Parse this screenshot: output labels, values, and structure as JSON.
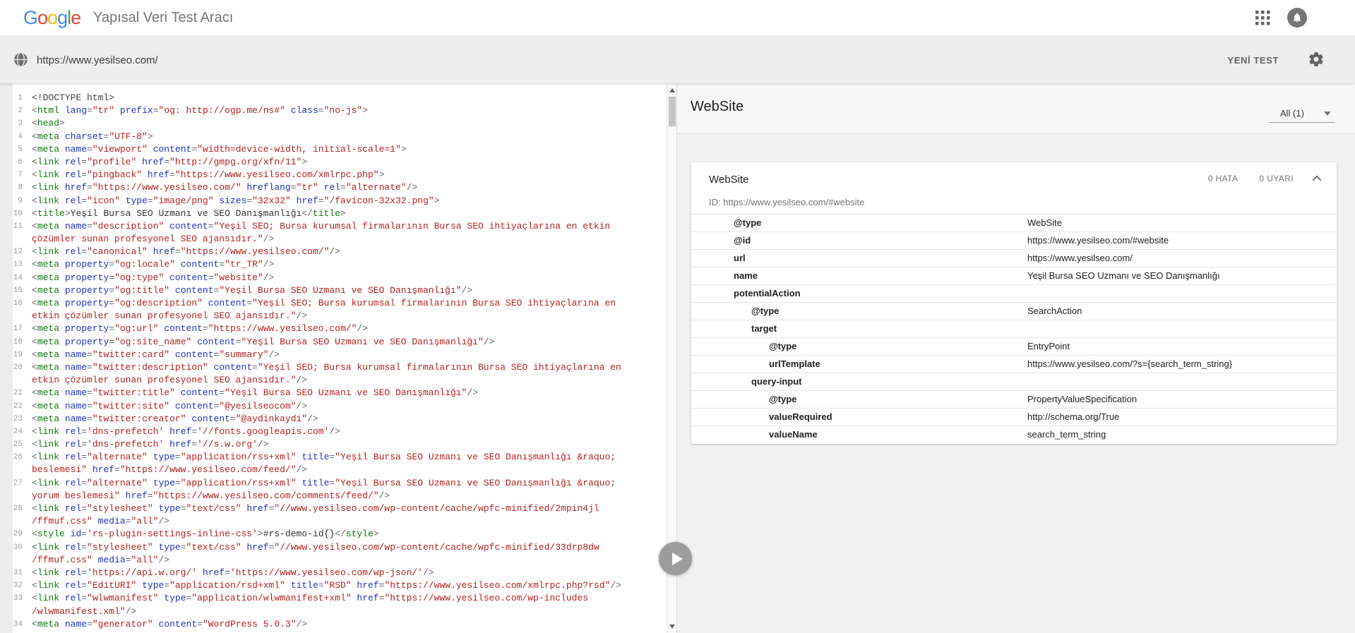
{
  "header": {
    "title": "Yapısal Veri Test Aracı",
    "logo_letters": [
      {
        "ch": "G",
        "color": "#4285F4"
      },
      {
        "ch": "o",
        "color": "#EA4335"
      },
      {
        "ch": "o",
        "color": "#FBBC05"
      },
      {
        "ch": "g",
        "color": "#4285F4"
      },
      {
        "ch": "l",
        "color": "#34A853"
      },
      {
        "ch": "e",
        "color": "#EA4335"
      }
    ]
  },
  "toolbar": {
    "url": "https://www.yesilseo.com/",
    "new_test": "YENİ TEST"
  },
  "colors": {
    "code": {
      "tag": "#117711",
      "attr": "#2233bb",
      "value": "#b22222",
      "punct": "#666666",
      "plain": "#333333",
      "doctype": "#444444"
    }
  },
  "code": {
    "rows": [
      {
        "n": "1",
        "t": "<!DOCTYPE html>"
      },
      {
        "n": "2",
        "t": "<html lang=\"tr\" prefix=\"og: http://ogp.me/ns#\" class=\"no-js\">"
      },
      {
        "n": "3",
        "t": "<head>"
      },
      {
        "n": "4",
        "t": "<meta charset=\"UTF-8\">"
      },
      {
        "n": "5",
        "t": "<meta name=\"viewport\" content=\"width=device-width, initial-scale=1\">"
      },
      {
        "n": "6",
        "t": "<link rel=\"profile\" href=\"http://gmpg.org/xfn/11\">"
      },
      {
        "n": "7",
        "t": "<link rel=\"pingback\" href=\"https://www.yesilseo.com/xmlrpc.php\">"
      },
      {
        "n": "8",
        "t": "<link href=\"https://www.yesilseo.com/\" hreflang=\"tr\" rel=\"alternate\"/>"
      },
      {
        "n": "9",
        "t": "<link rel=\"icon\" type=\"image/png\" sizes=\"32x32\" href=\"/favicon-32x32.png\">"
      },
      {
        "n": "10",
        "t": "<title>Yeşil Bursa SEO Uzmanı ve SEO Danışmanlığı</title>"
      },
      {
        "n": "11",
        "t": "<meta name=\"description\" content=\"Yeşil SEO; Bursa kurumsal firmalarının Bursa SEO ihtiyaçlarına en etkin"
      },
      {
        "n": "",
        "t": "çözümler sunan profesyonel SEO ajansıdır.\"/>"
      },
      {
        "n": "12",
        "t": "<link rel=\"canonical\" href=\"https://www.yesilseo.com/\"/>"
      },
      {
        "n": "13",
        "t": "<meta property=\"og:locale\" content=\"tr_TR\"/>"
      },
      {
        "n": "14",
        "t": "<meta property=\"og:type\" content=\"website\"/>"
      },
      {
        "n": "15",
        "t": "<meta property=\"og:title\" content=\"Yeşil Bursa SEO Uzmanı ve SEO Danışmanlığı\"/>"
      },
      {
        "n": "16",
        "t": "<meta property=\"og:description\" content=\"Yeşil SEO; Bursa kurumsal firmalarının Bursa SEO ihtiyaçlarına en"
      },
      {
        "n": "",
        "t": "etkin çözümler sunan profesyonel SEO ajansıdır.\"/>"
      },
      {
        "n": "17",
        "t": "<meta property=\"og:url\" content=\"https://www.yesilseo.com/\"/>"
      },
      {
        "n": "18",
        "t": "<meta property=\"og:site_name\" content=\"Yeşil Bursa SEO Uzmanı ve SEO Danışmanlığı\"/>"
      },
      {
        "n": "19",
        "t": "<meta name=\"twitter:card\" content=\"summary\"/>"
      },
      {
        "n": "20",
        "t": "<meta name=\"twitter:description\" content=\"Yeşil SEO; Bursa kurumsal firmalarının Bursa SEO ihtiyaçlarına en"
      },
      {
        "n": "",
        "t": "etkin çözümler sunan profesyonel SEO ajansıdır.\"/>"
      },
      {
        "n": "21",
        "t": "<meta name=\"twitter:title\" content=\"Yeşil Bursa SEO Uzmanı ve SEO Danışmanlığı\"/>"
      },
      {
        "n": "22",
        "t": "<meta name=\"twitter:site\" content=\"@yesilseocom\"/>"
      },
      {
        "n": "23",
        "t": "<meta name=\"twitter:creator\" content=\"@aydinkaydi\"/>"
      },
      {
        "n": "24",
        "t": "<link rel='dns-prefetch' href='//fonts.googleapis.com'/>"
      },
      {
        "n": "25",
        "t": "<link rel='dns-prefetch' href='//s.w.org'/>"
      },
      {
        "n": "26",
        "t": "<link rel=\"alternate\" type=\"application/rss+xml\" title=\"Yeşil Bursa SEO Uzmanı ve SEO Danışmanlığı &raquo;"
      },
      {
        "n": "",
        "t": "beslemesi\" href=\"https://www.yesilseo.com/feed/\"/>"
      },
      {
        "n": "27",
        "t": "<link rel=\"alternate\" type=\"application/rss+xml\" title=\"Yeşil Bursa SEO Uzmanı ve SEO Danışmanlığı &raquo;"
      },
      {
        "n": "",
        "t": "yorum beslemesi\" href=\"https://www.yesilseo.com/comments/feed/\"/>"
      },
      {
        "n": "28",
        "t": "<link rel=\"stylesheet\" type=\"text/css\" href=\"//www.yesilseo.com/wp-content/cache/wpfc-minified/2mpin4jl"
      },
      {
        "n": "",
        "t": "/ffmuf.css\" media=\"all\"/>"
      },
      {
        "n": "29",
        "t": "<style id='rs-plugin-settings-inline-css'>#rs-demo-id{}</style>"
      },
      {
        "n": "30",
        "t": "<link rel=\"stylesheet\" type=\"text/css\" href=\"//www.yesilseo.com/wp-content/cache/wpfc-minified/33drp8dw"
      },
      {
        "n": "",
        "t": "/ffmuf.css\" media=\"all\"/>"
      },
      {
        "n": "31",
        "t": "<link rel='https://api.w.org/' href='https://www.yesilseo.com/wp-json/'/>"
      },
      {
        "n": "32",
        "t": "<link rel=\"EditURI\" type=\"application/rsd+xml\" title=\"RSD\" href=\"https://www.yesilseo.com/xmlrpc.php?rsd\"/>"
      },
      {
        "n": "33",
        "t": "<link rel=\"wlwmanifest\" type=\"application/wlwmanifest+xml\" href=\"https://www.yesilseo.com/wp-includes"
      },
      {
        "n": "",
        "t": "/wlwmanifest.xml\"/>"
      },
      {
        "n": "34",
        "t": "<meta name=\"generator\" content=\"WordPress 5.0.3\"/>"
      }
    ]
  },
  "result": {
    "panel_title": "WebSite",
    "filter_label": "All (1)",
    "card": {
      "title": "WebSite",
      "errors": "0 HATA",
      "warnings": "0 UYARI",
      "id_line": "ID: https://www.yesilseo.com/#website",
      "rows": [
        {
          "level": 1,
          "key": "@type",
          "value": "WebSite"
        },
        {
          "level": 1,
          "key": "@id",
          "value": "https://www.yesilseo.com/#website"
        },
        {
          "level": 1,
          "key": "url",
          "value": "https://www.yesilseo.com/"
        },
        {
          "level": 1,
          "key": "name",
          "value": "Yeşil Bursa SEO Uzmanı ve SEO Danışmanlığı"
        },
        {
          "level": 1,
          "key": "potentialAction",
          "value": ""
        },
        {
          "level": 2,
          "key": "@type",
          "value": "SearchAction"
        },
        {
          "level": 2,
          "key": "target",
          "value": ""
        },
        {
          "level": 3,
          "key": "@type",
          "value": "EntryPoint"
        },
        {
          "level": 3,
          "key": "urlTemplate",
          "value": "https://www.yesilseo.com/?s={search_term_string}"
        },
        {
          "level": 2,
          "key": "query-input",
          "value": ""
        },
        {
          "level": 3,
          "key": "@type",
          "value": "PropertyValueSpecification"
        },
        {
          "level": 3,
          "key": "valueRequired",
          "value": "http://schema.org/True"
        },
        {
          "level": 3,
          "key": "valueName",
          "value": "search_term_string"
        }
      ]
    }
  }
}
